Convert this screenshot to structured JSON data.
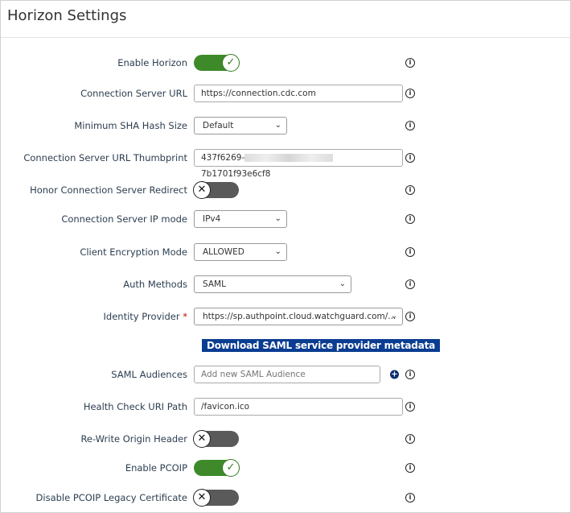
{
  "title": "Horizon Settings",
  "fields": {
    "enable_horizon": {
      "label": "Enable Horizon",
      "on": true
    },
    "server_url": {
      "label": "Connection Server URL",
      "value": "https://connection.cdc.com"
    },
    "sha": {
      "label": "Minimum SHA Hash Size",
      "value": "Default"
    },
    "thumb": {
      "label": "Connection Server URL Thumbprint",
      "value_start": "437f6269-",
      "value_end": "7b1701f93e6cf8"
    },
    "redirect": {
      "label": "Honor Connection Server Redirect",
      "on": false
    },
    "ip_mode": {
      "label": "Connection Server IP mode",
      "value": "IPv4"
    },
    "encryption": {
      "label": "Client Encryption Mode",
      "value": "ALLOWED"
    },
    "auth": {
      "label": "Auth Methods",
      "value": "SAML"
    },
    "idp": {
      "label": "Identity Provider",
      "required": "*",
      "value": "https://sp.authpoint.cloud.watchguard.com/..."
    },
    "download": "Download SAML service provider metadata",
    "audiences": {
      "label": "SAML Audiences",
      "placeholder": "Add new SAML Audience"
    },
    "health": {
      "label": "Health Check URI Path",
      "value": "/favicon.ico"
    },
    "rewrite": {
      "label": "Re-Write Origin Header",
      "on": false
    },
    "pcoip": {
      "label": "Enable PCOIP",
      "on": true
    },
    "pcoip_legacy": {
      "label": "Disable PCOIP Legacy Certificate",
      "on": false
    }
  },
  "icons": {
    "info": "i",
    "check": "✓",
    "x": "✕",
    "chevron": "⌄",
    "plus": "+"
  }
}
